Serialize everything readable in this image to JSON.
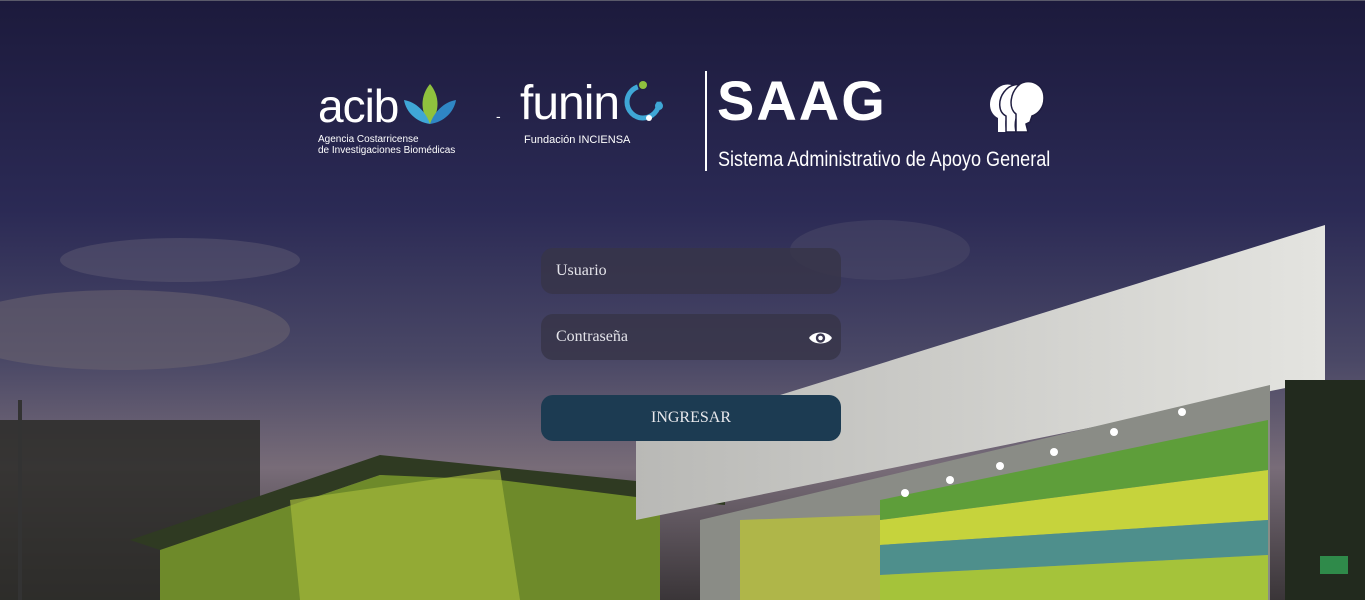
{
  "logos": {
    "acib": {
      "word": "acib",
      "subtitle_line1": "Agencia Costarricense",
      "subtitle_line2": "de Investigaciones Biomédicas"
    },
    "separator": "-",
    "funin": {
      "word": "funin",
      "subtitle": "Fundación INCIENSA"
    },
    "saag": {
      "word": "SAAG",
      "subtitle": "Sistema Administrativo de Apoyo General"
    }
  },
  "form": {
    "username": {
      "placeholder": "Usuario",
      "value": ""
    },
    "password": {
      "placeholder": "Contraseña",
      "value": ""
    },
    "submit_label": "INGRESAR"
  },
  "icons": {
    "toggle_password": "eye-icon",
    "saag_emblem": "heads-profile-icon",
    "acib_emblem": "leaf-icon",
    "funin_emblem": "circle-dots-icon"
  },
  "colors": {
    "button_bg": "#1c3b52",
    "field_bg": "#373448",
    "text": "#ffffff"
  }
}
